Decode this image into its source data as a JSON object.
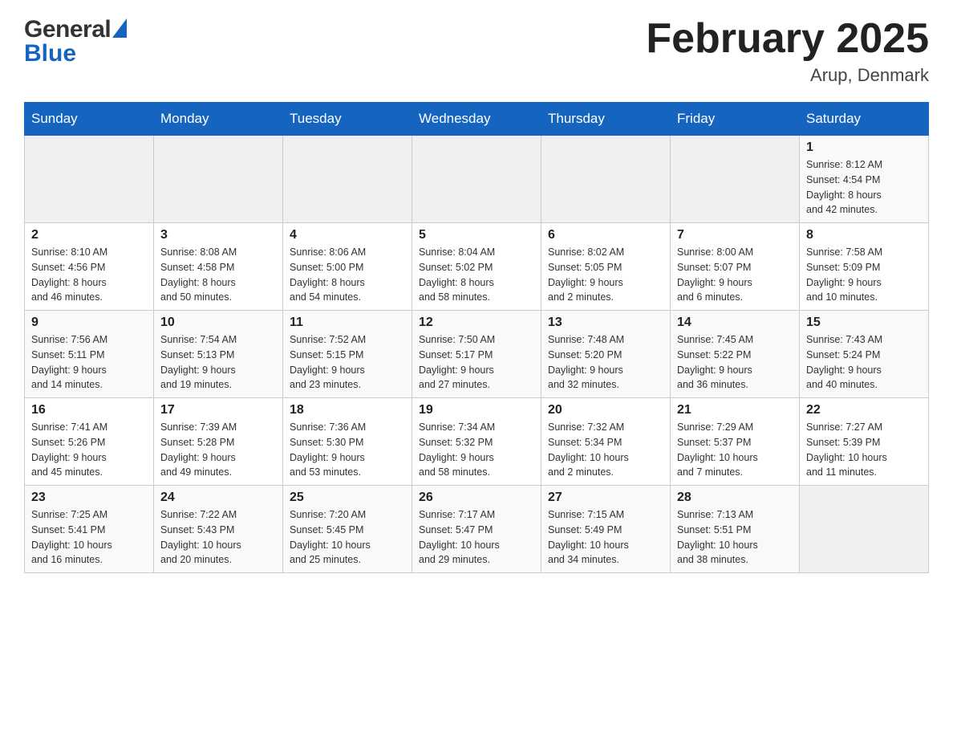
{
  "header": {
    "logo_general": "General",
    "logo_blue": "Blue",
    "month_title": "February 2025",
    "location": "Arup, Denmark"
  },
  "weekdays": [
    "Sunday",
    "Monday",
    "Tuesday",
    "Wednesday",
    "Thursday",
    "Friday",
    "Saturday"
  ],
  "weeks": [
    [
      {
        "day": "",
        "info": ""
      },
      {
        "day": "",
        "info": ""
      },
      {
        "day": "",
        "info": ""
      },
      {
        "day": "",
        "info": ""
      },
      {
        "day": "",
        "info": ""
      },
      {
        "day": "",
        "info": ""
      },
      {
        "day": "1",
        "info": "Sunrise: 8:12 AM\nSunset: 4:54 PM\nDaylight: 8 hours\nand 42 minutes."
      }
    ],
    [
      {
        "day": "2",
        "info": "Sunrise: 8:10 AM\nSunset: 4:56 PM\nDaylight: 8 hours\nand 46 minutes."
      },
      {
        "day": "3",
        "info": "Sunrise: 8:08 AM\nSunset: 4:58 PM\nDaylight: 8 hours\nand 50 minutes."
      },
      {
        "day": "4",
        "info": "Sunrise: 8:06 AM\nSunset: 5:00 PM\nDaylight: 8 hours\nand 54 minutes."
      },
      {
        "day": "5",
        "info": "Sunrise: 8:04 AM\nSunset: 5:02 PM\nDaylight: 8 hours\nand 58 minutes."
      },
      {
        "day": "6",
        "info": "Sunrise: 8:02 AM\nSunset: 5:05 PM\nDaylight: 9 hours\nand 2 minutes."
      },
      {
        "day": "7",
        "info": "Sunrise: 8:00 AM\nSunset: 5:07 PM\nDaylight: 9 hours\nand 6 minutes."
      },
      {
        "day": "8",
        "info": "Sunrise: 7:58 AM\nSunset: 5:09 PM\nDaylight: 9 hours\nand 10 minutes."
      }
    ],
    [
      {
        "day": "9",
        "info": "Sunrise: 7:56 AM\nSunset: 5:11 PM\nDaylight: 9 hours\nand 14 minutes."
      },
      {
        "day": "10",
        "info": "Sunrise: 7:54 AM\nSunset: 5:13 PM\nDaylight: 9 hours\nand 19 minutes."
      },
      {
        "day": "11",
        "info": "Sunrise: 7:52 AM\nSunset: 5:15 PM\nDaylight: 9 hours\nand 23 minutes."
      },
      {
        "day": "12",
        "info": "Sunrise: 7:50 AM\nSunset: 5:17 PM\nDaylight: 9 hours\nand 27 minutes."
      },
      {
        "day": "13",
        "info": "Sunrise: 7:48 AM\nSunset: 5:20 PM\nDaylight: 9 hours\nand 32 minutes."
      },
      {
        "day": "14",
        "info": "Sunrise: 7:45 AM\nSunset: 5:22 PM\nDaylight: 9 hours\nand 36 minutes."
      },
      {
        "day": "15",
        "info": "Sunrise: 7:43 AM\nSunset: 5:24 PM\nDaylight: 9 hours\nand 40 minutes."
      }
    ],
    [
      {
        "day": "16",
        "info": "Sunrise: 7:41 AM\nSunset: 5:26 PM\nDaylight: 9 hours\nand 45 minutes."
      },
      {
        "day": "17",
        "info": "Sunrise: 7:39 AM\nSunset: 5:28 PM\nDaylight: 9 hours\nand 49 minutes."
      },
      {
        "day": "18",
        "info": "Sunrise: 7:36 AM\nSunset: 5:30 PM\nDaylight: 9 hours\nand 53 minutes."
      },
      {
        "day": "19",
        "info": "Sunrise: 7:34 AM\nSunset: 5:32 PM\nDaylight: 9 hours\nand 58 minutes."
      },
      {
        "day": "20",
        "info": "Sunrise: 7:32 AM\nSunset: 5:34 PM\nDaylight: 10 hours\nand 2 minutes."
      },
      {
        "day": "21",
        "info": "Sunrise: 7:29 AM\nSunset: 5:37 PM\nDaylight: 10 hours\nand 7 minutes."
      },
      {
        "day": "22",
        "info": "Sunrise: 7:27 AM\nSunset: 5:39 PM\nDaylight: 10 hours\nand 11 minutes."
      }
    ],
    [
      {
        "day": "23",
        "info": "Sunrise: 7:25 AM\nSunset: 5:41 PM\nDaylight: 10 hours\nand 16 minutes."
      },
      {
        "day": "24",
        "info": "Sunrise: 7:22 AM\nSunset: 5:43 PM\nDaylight: 10 hours\nand 20 minutes."
      },
      {
        "day": "25",
        "info": "Sunrise: 7:20 AM\nSunset: 5:45 PM\nDaylight: 10 hours\nand 25 minutes."
      },
      {
        "day": "26",
        "info": "Sunrise: 7:17 AM\nSunset: 5:47 PM\nDaylight: 10 hours\nand 29 minutes."
      },
      {
        "day": "27",
        "info": "Sunrise: 7:15 AM\nSunset: 5:49 PM\nDaylight: 10 hours\nand 34 minutes."
      },
      {
        "day": "28",
        "info": "Sunrise: 7:13 AM\nSunset: 5:51 PM\nDaylight: 10 hours\nand 38 minutes."
      },
      {
        "day": "",
        "info": ""
      }
    ]
  ]
}
